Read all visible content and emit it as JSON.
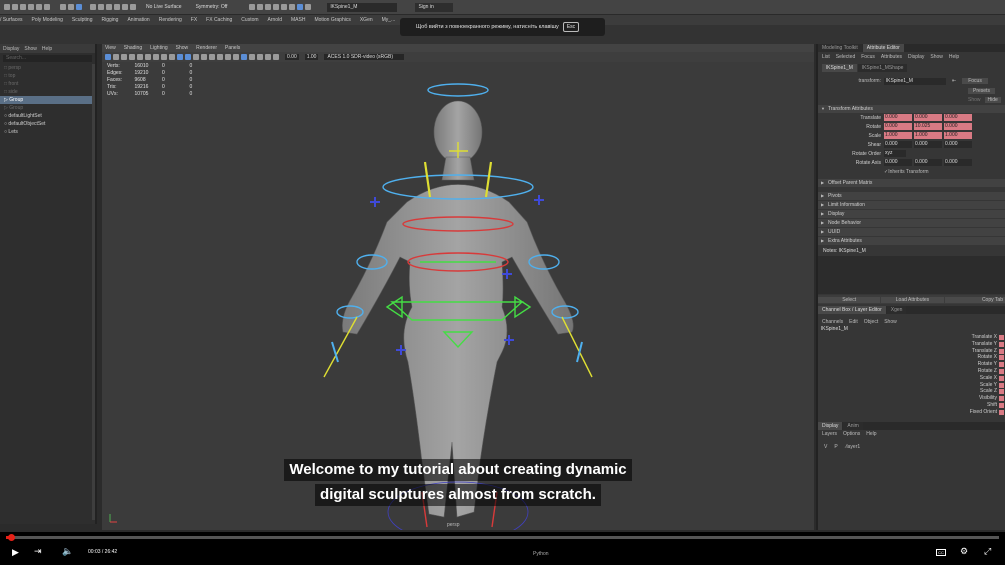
{
  "topbar": {
    "workspace": "No Live Surface",
    "symmetry": "Symmetry: Off",
    "object_field": "lKSpine1_M",
    "sign_in": "Sign in"
  },
  "shelf_tabs": [
    "/ Surfaces",
    "Poly Modeling",
    "Sculpting",
    "Rigging",
    "Animation",
    "Rendering",
    "FX",
    "FX Caching",
    "Custom",
    "Arnold",
    "MASH",
    "Motion Graphics",
    "XGen",
    "My_..."
  ],
  "outliner": {
    "menus": [
      "Display",
      "Show",
      "Help"
    ],
    "search_placeholder": "Search...",
    "items": [
      {
        "label": "persp",
        "dim": true,
        "selected": false
      },
      {
        "label": "top",
        "dim": true,
        "selected": false
      },
      {
        "label": "front",
        "dim": true,
        "selected": false
      },
      {
        "label": "side",
        "dim": true,
        "selected": false
      },
      {
        "label": "Group",
        "dim": false,
        "selected": true
      },
      {
        "label": "Group",
        "dim": true,
        "selected": false
      },
      {
        "label": "defaultLightSet",
        "dim": false,
        "selected": false
      },
      {
        "label": "defaultObjectSet",
        "dim": false,
        "selected": false
      },
      {
        "label": "Lets",
        "dim": false,
        "selected": false
      }
    ]
  },
  "viewport": {
    "menus": [
      "View",
      "Shading",
      "Lighting",
      "Show",
      "Renderer",
      "Panels"
    ],
    "exposure": "0.00",
    "gamma": "1.00",
    "color_space": "ACES 1.0 SDR-video (sRGB)",
    "camera_label": "persp",
    "hud": [
      {
        "name": "Verts:",
        "v1": "16010",
        "v2": "0",
        "v3": "0"
      },
      {
        "name": "Edges:",
        "v1": "19210",
        "v2": "0",
        "v3": "0"
      },
      {
        "name": "Faces:",
        "v1": "9608",
        "v2": "0",
        "v3": "0"
      },
      {
        "name": "Tris:",
        "v1": "19216",
        "v2": "0",
        "v3": "0"
      },
      {
        "name": "UVs:",
        "v1": "10705",
        "v2": "0",
        "v3": "0"
      }
    ]
  },
  "fullscreen_toast": {
    "text": "Щоб вийти з повноекранного режиму, натисніть клавішу",
    "key": "Esc"
  },
  "subtitle": {
    "line1": "Welcome to my tutorial about creating dynamic",
    "line2": "digital sculptures almost from scratch."
  },
  "attribute_editor": {
    "tabs": [
      "Modeling Toolkit",
      "Attribute Editor"
    ],
    "menu": [
      "List",
      "Selected",
      "Focus",
      "Attributes",
      "Display",
      "Show",
      "Help"
    ],
    "node_tabs": [
      "lKSpine1_M",
      "lKSpine1_MShape"
    ],
    "transform_label": "transform:",
    "transform_value": "lKSpine1_M",
    "focus_btn": "Focus",
    "presets_btn": "Presets",
    "show_label": "Show",
    "hide_label": "Hide",
    "section_transform": "Transform Attributes",
    "translate": {
      "label": "Translate",
      "x": "0.000",
      "y": "0.000",
      "z": "0.000"
    },
    "rotate": {
      "label": "Rotate",
      "x": "0.000",
      "y": "10.025",
      "z": "0.000"
    },
    "scale": {
      "label": "Scale",
      "x": "1.000",
      "y": "1.000",
      "z": "1.000"
    },
    "shear": {
      "label": "Shear",
      "x": "0.000",
      "y": "0.000",
      "z": "0.000"
    },
    "rotate_order": {
      "label": "Rotate Order",
      "value": "xyz"
    },
    "rotate_axis": {
      "label": "Rotate Axis",
      "x": "0.000",
      "y": "0.000",
      "z": "0.000"
    },
    "inherits": "Inherits Transform",
    "offset_parent": "Offset Parent Matrix",
    "sections": [
      "Pivots",
      "Limit Information",
      "Display",
      "Node Behavior",
      "UUID",
      "Extra Attributes"
    ],
    "notes": "Notes: lKSpine1_M",
    "buttons": [
      "Select",
      "Load Attributes",
      "Copy Tab"
    ]
  },
  "channel_box": {
    "tabs": [
      "Channel Box / Layer Editor",
      "Xgen"
    ],
    "menu": [
      "Channels",
      "Edit",
      "Object",
      "Show"
    ],
    "node": "lKSpine1_M",
    "channels": [
      "Translate X",
      "Translate Y",
      "Translate Z",
      "Rotate X",
      "Rotate Y",
      "Rotate Z",
      "Scale X",
      "Scale Y",
      "Scale Z",
      "Visibility",
      "Shift",
      "Fixed Orient"
    ]
  },
  "layer_editor": {
    "tabs": [
      "Display",
      "Anim"
    ],
    "menu": [
      "Layers",
      "Options",
      "Help"
    ],
    "layer_v": "V",
    "layer_p": "P",
    "layer_name": "layer1"
  },
  "player": {
    "progress_fraction": 0.005,
    "time": "00:03 / 26:42",
    "chapter": "Python"
  }
}
